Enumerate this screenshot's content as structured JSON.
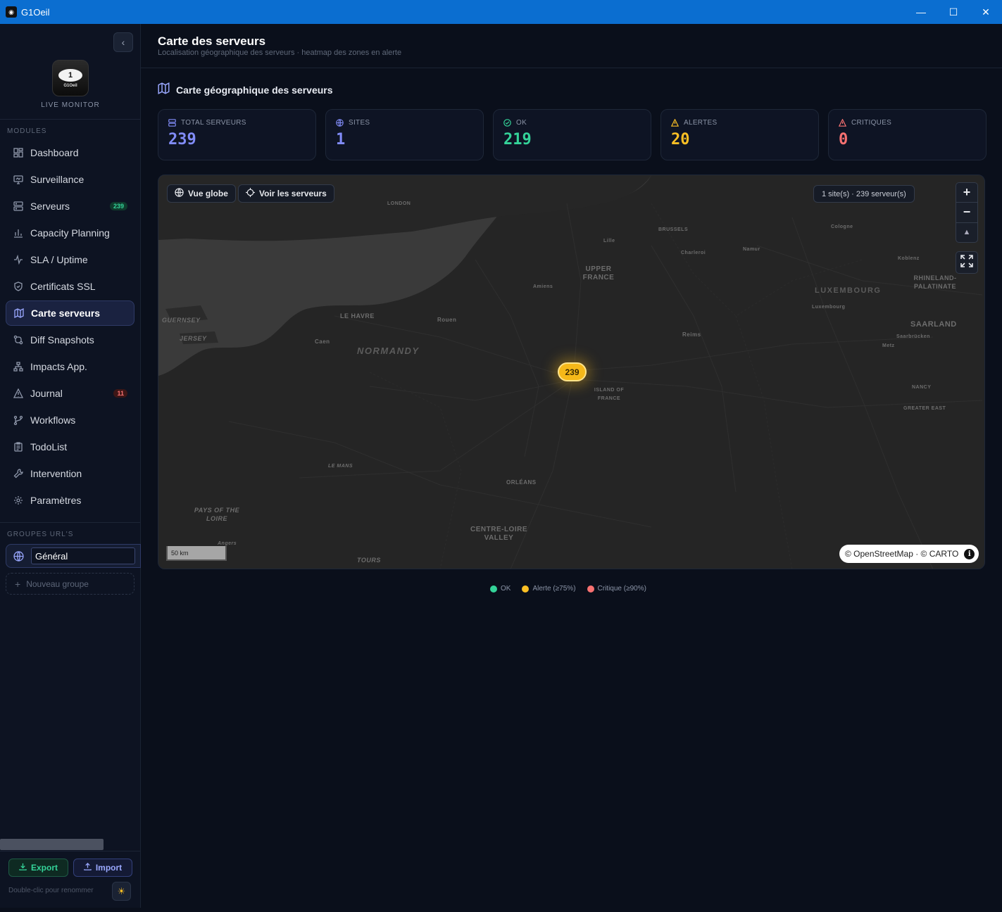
{
  "window": {
    "title": "G1Oeil"
  },
  "sidebar": {
    "brand_sub": "LIVE MONITOR",
    "logo_text": "G1Oeil",
    "modules_label": "MODULES",
    "items": [
      {
        "label": "Dashboard",
        "icon": "dashboard-icon"
      },
      {
        "label": "Surveillance",
        "icon": "monitor-icon"
      },
      {
        "label": "Serveurs",
        "icon": "server-icon",
        "badge": "239"
      },
      {
        "label": "Capacity Planning",
        "icon": "bar-chart-icon"
      },
      {
        "label": "SLA / Uptime",
        "icon": "activity-icon"
      },
      {
        "label": "Certificats SSL",
        "icon": "shield-icon"
      },
      {
        "label": "Carte serveurs",
        "icon": "map-icon",
        "active": true
      },
      {
        "label": "Diff Snapshots",
        "icon": "git-compare-icon"
      },
      {
        "label": "Impacts App.",
        "icon": "network-icon"
      },
      {
        "label": "Journal",
        "icon": "warning-icon",
        "badge": "11"
      },
      {
        "label": "Workflows",
        "icon": "workflow-icon"
      },
      {
        "label": "TodoList",
        "icon": "clipboard-icon"
      },
      {
        "label": "Intervention",
        "icon": "wrench-icon"
      },
      {
        "label": "Paramètres",
        "icon": "gear-icon"
      }
    ],
    "groups_label": "GROUPES URL'S",
    "group_value": "Général",
    "new_group": "Nouveau groupe",
    "export_label": "Export",
    "import_label": "Import",
    "hint": "Double-clic pour renommer"
  },
  "header": {
    "title": "Carte des serveurs",
    "subtitle": "Localisation géographique des serveurs · heatmap des zones en alerte"
  },
  "section": {
    "title": "Carte géographique des serveurs"
  },
  "stats": [
    {
      "label": "TOTAL SERVEURS",
      "value": "239",
      "color": "#818cf8",
      "icon": "server-icon"
    },
    {
      "label": "SITES",
      "value": "1",
      "color": "#818cf8",
      "icon": "globe-icon"
    },
    {
      "label": "OK",
      "value": "219",
      "color": "#34d399",
      "icon": "check-circle-icon"
    },
    {
      "label": "ALERTES",
      "value": "20",
      "color": "#fbbf24",
      "icon": "warning-icon"
    },
    {
      "label": "CRITIQUES",
      "value": "0",
      "color": "#f87171",
      "icon": "alert-triangle-icon"
    }
  ],
  "map": {
    "globe_btn": "Vue globe",
    "servers_btn": "Voir les serveurs",
    "site_count": "1 site(s) · 239 serveur(s)",
    "cluster": "239",
    "scale": "50 km",
    "attribution": "© OpenStreetMap · © CARTO",
    "labels": {
      "normandy": "NORMANDY",
      "upper_france": "UPPER FRANCE",
      "island_of_france": "ISLAND OF FRANCE",
      "centre": "CENTRE-LOIRE VALLEY",
      "pays_loire": "PAYS OF THE LOIRE",
      "luxembourg": "LUXEMBOURG",
      "rhineland": "RHINELAND-PALATINATE",
      "saarland": "SAARLAND",
      "grand_est": "GREATER EAST",
      "london": "LONDON",
      "brussels": "BRUSSELS",
      "le_havre": "LE HAVRE",
      "rouen": "Rouen",
      "caen": "Caen",
      "amiens": "Amiens",
      "reims": "Reims",
      "metz": "Metz",
      "lille": "Lille",
      "orleans": "ORLÉANS",
      "le_mans": "LE MANS",
      "tours": "TOURS",
      "angers": "Angers",
      "jersey": "JERSEY",
      "guernsey": "GUERNSEY",
      "nancy": "NANCY",
      "saarbrucken": "Saarbrücken",
      "charleroi": "Charleroi",
      "luxembourg_city": "Luxembourg",
      "cologne": "Cologne",
      "koblenz": "Koblenz",
      "namur": "Namur"
    }
  },
  "legend": [
    {
      "label": "OK",
      "color": "#34d399"
    },
    {
      "label": "Alerte (≥75%)",
      "color": "#fbbf24"
    },
    {
      "label": "Critique (≥90%)",
      "color": "#f87171"
    }
  ]
}
